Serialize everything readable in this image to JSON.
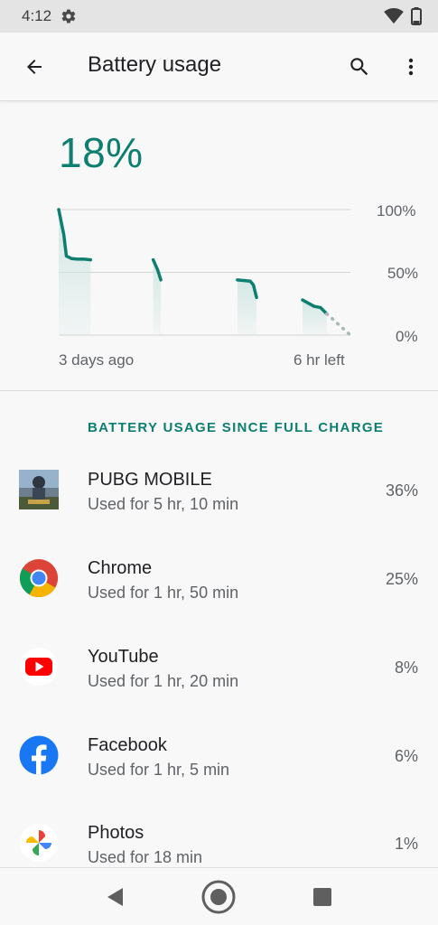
{
  "status_bar": {
    "time": "4:12"
  },
  "app_bar": {
    "title": "Battery usage"
  },
  "battery": {
    "percent": "18%"
  },
  "chart_data": {
    "type": "line",
    "y_axis_labels": [
      "100%",
      "50%",
      "0%"
    ],
    "x_axis_labels": [
      "3 days ago",
      "6 hr left"
    ],
    "ylim": [
      0,
      100
    ],
    "grid": true,
    "segments": [
      {
        "x": [
          0,
          0.08,
          0.12,
          0.2,
          0.3,
          0.4,
          0.5
        ],
        "y": [
          100,
          80,
          63,
          61,
          60.5,
          60.5,
          60
        ]
      },
      {
        "x": [
          1.48,
          1.55,
          1.6
        ],
        "y": [
          60,
          52,
          44
        ]
      },
      {
        "x": [
          2.8,
          3.0,
          3.05,
          3.1
        ],
        "y": [
          44,
          43,
          40,
          30
        ]
      },
      {
        "x": [
          3.82,
          4.0,
          4.1,
          4.2
        ],
        "y": [
          28,
          23,
          22,
          17
        ]
      }
    ],
    "projection": {
      "x": [
        4.2,
        4.57
      ],
      "y": [
        17,
        0
      ]
    },
    "x_range": [
      0,
      4.57
    ],
    "line_color": "#0d7e70",
    "fill_color": "#cfe6e2",
    "projection_color": "#a7b8b5"
  },
  "section": {
    "header": "BATTERY USAGE SINCE FULL CHARGE"
  },
  "apps": [
    {
      "name": "PUBG MOBILE",
      "usage": "Used for 5 hr, 10 min",
      "percent": "36%",
      "icon": "pubg-icon"
    },
    {
      "name": "Chrome",
      "usage": "Used for 1 hr, 50 min",
      "percent": "25%",
      "icon": "chrome-icon"
    },
    {
      "name": "YouTube",
      "usage": "Used for 1 hr, 20 min",
      "percent": "8%",
      "icon": "youtube-icon"
    },
    {
      "name": "Facebook",
      "usage": "Used for 1 hr, 5 min",
      "percent": "6%",
      "icon": "facebook-icon"
    },
    {
      "name": "Photos",
      "usage": "Used for 18 min",
      "percent": "1%",
      "icon": "photos-icon"
    }
  ],
  "colors": {
    "accent": "#0d7e70"
  }
}
